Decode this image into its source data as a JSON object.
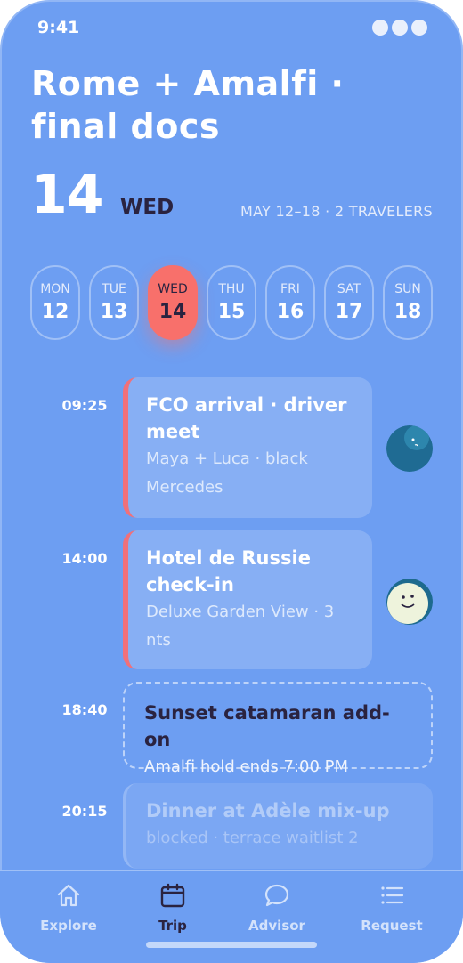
{
  "status": {
    "time": "9:41"
  },
  "header": {
    "title": "Rome + Amalfi · final docs",
    "day_number": "14",
    "day_of_week": "WED",
    "meta": "MAY 12–18 · 2 TRAVELERS"
  },
  "days": [
    {
      "name": "MON",
      "num": "12"
    },
    {
      "name": "TUE",
      "num": "13"
    },
    {
      "name": "WED",
      "num": "14",
      "active": true
    },
    {
      "name": "THU",
      "num": "15"
    },
    {
      "name": "FRI",
      "num": "16"
    },
    {
      "name": "SAT",
      "num": "17"
    },
    {
      "name": "SUN",
      "num": "18"
    }
  ],
  "events": [
    {
      "time": "09:25",
      "title": "FCO arrival · driver meet",
      "subtitle": "Maya + Luca · black Mercedes",
      "avatar": "teal-face-icon"
    },
    {
      "time": "14:00",
      "title": "Hotel de Russie check-in",
      "subtitle": "Deluxe Garden View · 3 nts",
      "avatar": "smiley-face-icon"
    },
    {
      "time": "18:40",
      "title": "Sunset catamaran add-on",
      "subtitle": "Amalfi hold ends 7:00 PM"
    },
    {
      "time": "20:15",
      "title": "Dinner at Adèle mix-up",
      "subtitle": "blocked · terrace waitlist 2"
    }
  ],
  "tabs": [
    {
      "label": "Explore",
      "icon": "home-icon"
    },
    {
      "label": "Trip",
      "icon": "calendar-icon",
      "active": true
    },
    {
      "label": "Advisor",
      "icon": "chat-icon"
    },
    {
      "label": "Request",
      "icon": "list-icon"
    }
  ],
  "colors": {
    "background": "#6d9ef2",
    "accent": "#f8706b",
    "dark_text": "#2a2340"
  }
}
